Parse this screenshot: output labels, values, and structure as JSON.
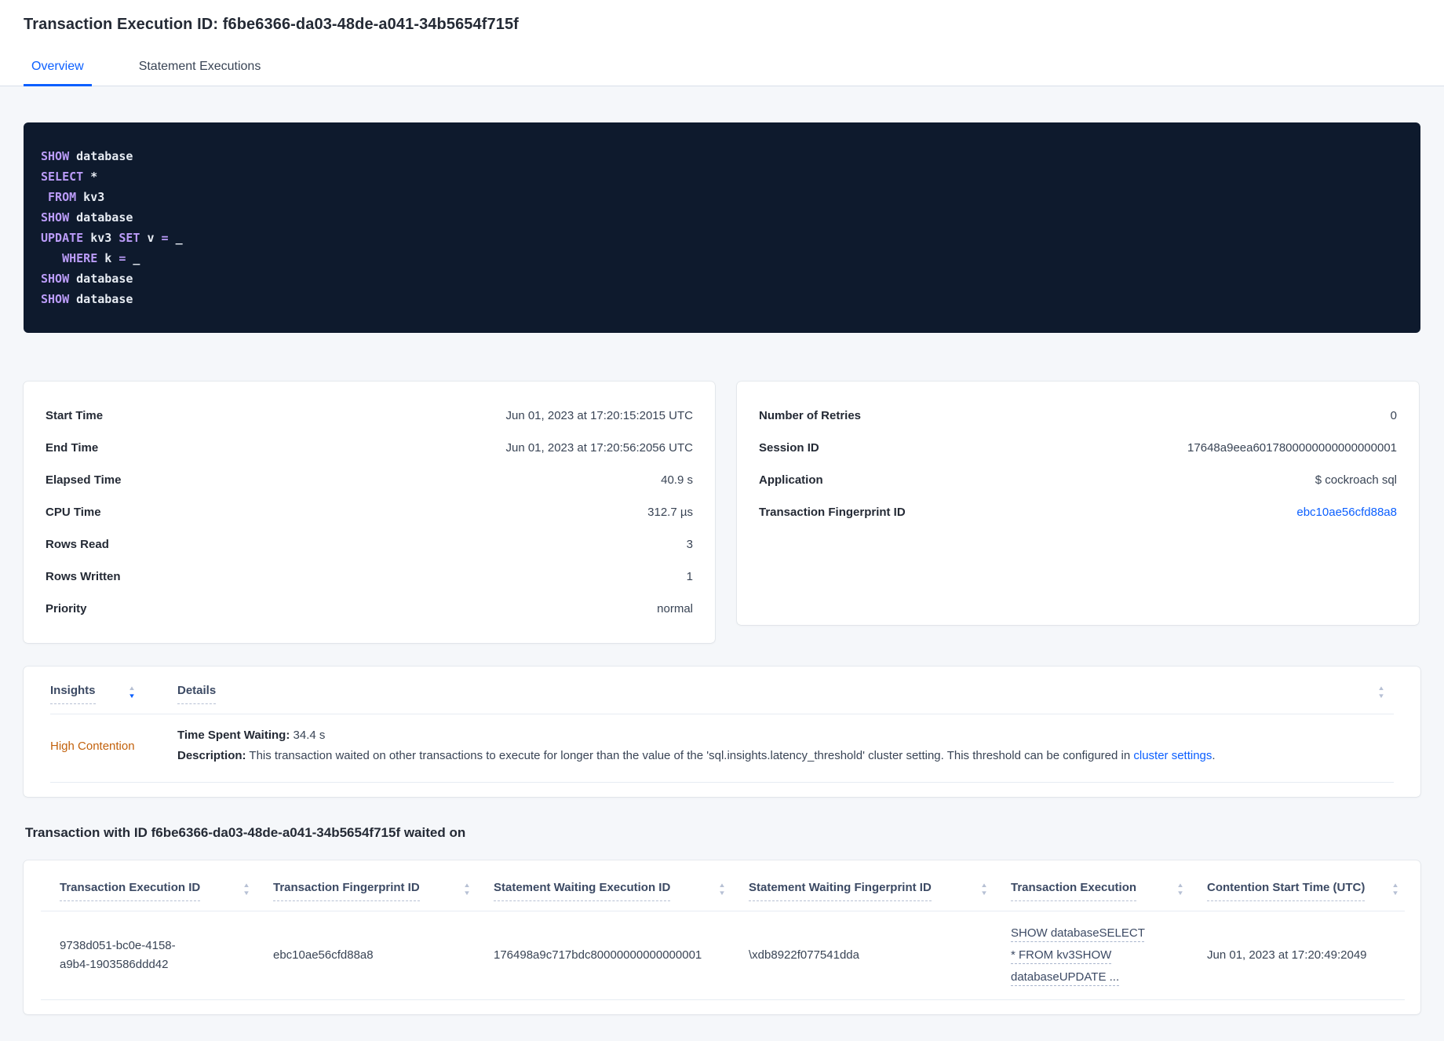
{
  "header": {
    "title": "Transaction Execution ID: f6be6366-da03-48de-a041-34b5654f715f",
    "tabs": [
      {
        "label": "Overview",
        "active": true
      },
      {
        "label": "Statement Executions",
        "active": false
      }
    ]
  },
  "sql": {
    "lines": [
      {
        "segments": [
          {
            "text": "SHOW",
            "type": "keyword"
          },
          {
            "text": " database",
            "type": "plain"
          }
        ]
      },
      {
        "segments": [
          {
            "text": "SELECT",
            "type": "keyword"
          },
          {
            "text": " *",
            "type": "plain"
          }
        ]
      },
      {
        "segments": [
          {
            "text": " ",
            "type": "plain"
          },
          {
            "text": "FROM",
            "type": "keyword"
          },
          {
            "text": " kv3",
            "type": "plain"
          }
        ]
      },
      {
        "segments": [
          {
            "text": "SHOW",
            "type": "keyword"
          },
          {
            "text": " database",
            "type": "plain"
          }
        ]
      },
      {
        "segments": [
          {
            "text": "UPDATE",
            "type": "keyword"
          },
          {
            "text": " kv3 ",
            "type": "plain"
          },
          {
            "text": "SET",
            "type": "keyword"
          },
          {
            "text": " v ",
            "type": "plain"
          },
          {
            "text": "=",
            "type": "keyword"
          },
          {
            "text": " _",
            "type": "plain"
          }
        ]
      },
      {
        "segments": [
          {
            "text": "   ",
            "type": "plain"
          },
          {
            "text": "WHERE",
            "type": "keyword"
          },
          {
            "text": " k ",
            "type": "plain"
          },
          {
            "text": "=",
            "type": "keyword"
          },
          {
            "text": " _",
            "type": "plain"
          }
        ]
      },
      {
        "segments": [
          {
            "text": "SHOW",
            "type": "keyword"
          },
          {
            "text": " database",
            "type": "plain"
          }
        ]
      },
      {
        "segments": [
          {
            "text": "SHOW",
            "type": "keyword"
          },
          {
            "text": " database",
            "type": "plain"
          }
        ]
      }
    ]
  },
  "stats_left": {
    "rows": [
      {
        "label": "Start Time",
        "value": "Jun 01, 2023 at 17:20:15:2015 UTC"
      },
      {
        "label": "End Time",
        "value": "Jun 01, 2023 at 17:20:56:2056 UTC"
      },
      {
        "label": "Elapsed Time",
        "value": "40.9 s"
      },
      {
        "label": "CPU Time",
        "value": "312.7 µs"
      },
      {
        "label": "Rows Read",
        "value": "3"
      },
      {
        "label": "Rows Written",
        "value": "1"
      },
      {
        "label": "Priority",
        "value": "normal"
      }
    ]
  },
  "stats_right": {
    "rows": [
      {
        "label": "Number of Retries",
        "value": "0"
      },
      {
        "label": "Session ID",
        "value": "17648a9eea6017800000000000000001"
      },
      {
        "label": "Application",
        "value": "$ cockroach sql"
      },
      {
        "label": "Transaction Fingerprint ID",
        "value": "ebc10ae56cfd88a8",
        "link": true
      }
    ]
  },
  "insights_table": {
    "columns": [
      {
        "label": "Insights",
        "sort": "desc"
      },
      {
        "label": "Details",
        "sort": null
      }
    ],
    "rows": [
      {
        "insight": "High Contention",
        "waiting_label": "Time Spent Waiting:",
        "waiting_value": " 34.4 s",
        "description_label": "Description:",
        "description_text": " This transaction waited on other transactions to execute for longer than the value of the 'sql.insights.latency_threshold' cluster setting. This threshold can be configured in ",
        "description_link": "cluster settings",
        "description_suffix": "."
      }
    ]
  },
  "waited_on": {
    "heading": "Transaction with ID f6be6366-da03-48de-a041-34b5654f715f waited on",
    "columns": [
      "Transaction Execution ID",
      "Transaction Fingerprint ID",
      "Statement Waiting Execution ID",
      "Statement Waiting Fingerprint ID",
      "Transaction Execution",
      "Contention Start Time (UTC)"
    ],
    "rows": [
      {
        "transaction_execution_id": "9738d051-bc0e-4158-a9b4-1903586ddd42",
        "transaction_fingerprint_id": "ebc10ae56cfd88a8",
        "statement_waiting_execution_id": "176498a9c717bdc80000000000000001",
        "statement_waiting_fingerprint_id": "\\xdb8922f077541dda",
        "transaction_execution": "SHOW databaseSELECT * FROM kv3SHOW databaseUPDATE ...",
        "contention_start_time": "Jun 01, 2023 at 17:20:49:2049"
      }
    ]
  },
  "colors": {
    "accent_blue": "#0b5fff",
    "insight_warning_orange": "#c2610c",
    "code_background": "#0e1a2d",
    "code_keyword_purple": "#bb9cf9",
    "page_background": "#f5f7fa",
    "heading_text": "#242a35"
  }
}
